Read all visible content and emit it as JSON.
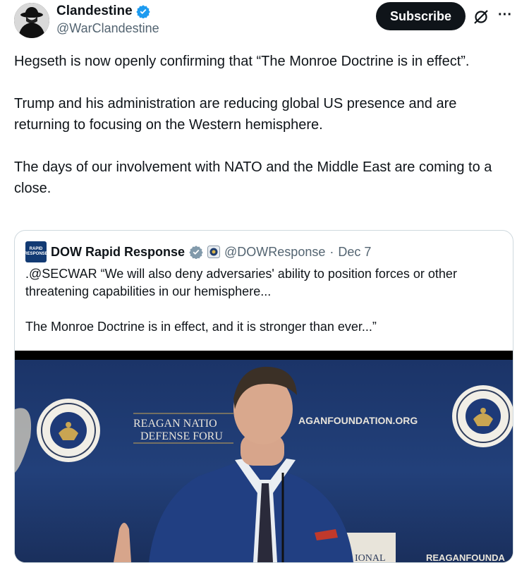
{
  "author": {
    "name": "Clandestine",
    "handle": "@WarClandestine"
  },
  "actions": {
    "subscribe_label": "Subscribe",
    "grok_icon": "grok-icon",
    "more_icon": "more-icon"
  },
  "tweet": {
    "paragraphs": [
      "Hegseth is now openly confirming that “The Monroe Doctrine is in effect”.",
      "Trump and his administration are reducing global US presence and are returning to focusing on the Western hemisphere.",
      "The days of our involvement with NATO and the Middle East are coming to a close."
    ]
  },
  "quote": {
    "name": "DOW Rapid Response",
    "handle": "@DOWResponse",
    "separator": "·",
    "date": "Dec 7",
    "avatar_text": "RAPID RESPONSE",
    "paragraphs": [
      ".@SECWAR “We will also deny adversaries' ability to position forces or other threatening capabilities in our hemisphere...",
      "The Monroe Doctrine is in effect, and it is stronger than ever...”"
    ]
  },
  "video": {
    "banner_line1": "REAGAN NATIO",
    "banner_line2": "DEFENSE FORU",
    "website": "AGANFOUNDATION.ORG",
    "seal_text": "RONALD REAGAN PRESIDENTIAL FOUNDATION & INSTITUTE",
    "bottom_left": "IONAL",
    "bottom_right": "REAGANFOUNDA"
  },
  "colors": {
    "verified_blue": "#1d9bf0",
    "text": "#0f1419",
    "secondary": "#536471",
    "border": "#cfd9de"
  }
}
